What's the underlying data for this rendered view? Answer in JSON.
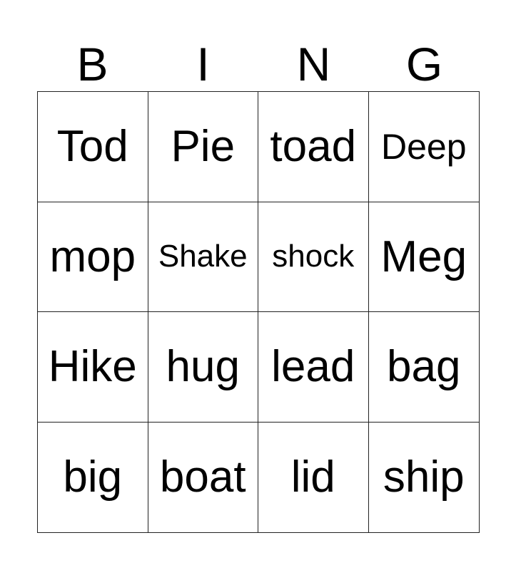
{
  "header": {
    "letters": [
      "B",
      "I",
      "N",
      "G"
    ]
  },
  "cells": [
    [
      "Tod",
      "Pie",
      "toad",
      "Deep"
    ],
    [
      "mop",
      "Shake",
      "shock",
      "Meg"
    ],
    [
      "Hike",
      "hug",
      "lead",
      "bag"
    ],
    [
      "big",
      "boat",
      "lid",
      "ship"
    ]
  ]
}
